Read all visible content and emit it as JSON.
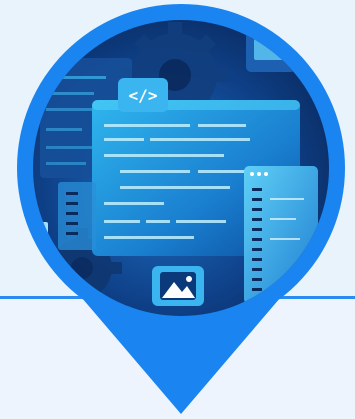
{
  "icons": {
    "code": "code-brackets-icon",
    "image": "image-picture-icon",
    "gear": "gear-icon"
  },
  "colors": {
    "background_top": "#e8f3fc",
    "background_bottom": "#eef4fd",
    "pin_ring": "#1a84f0",
    "divider": "#2a8cf0",
    "scene_dark": "#0b2a5c",
    "screen_glow": "#3fc3f5"
  }
}
